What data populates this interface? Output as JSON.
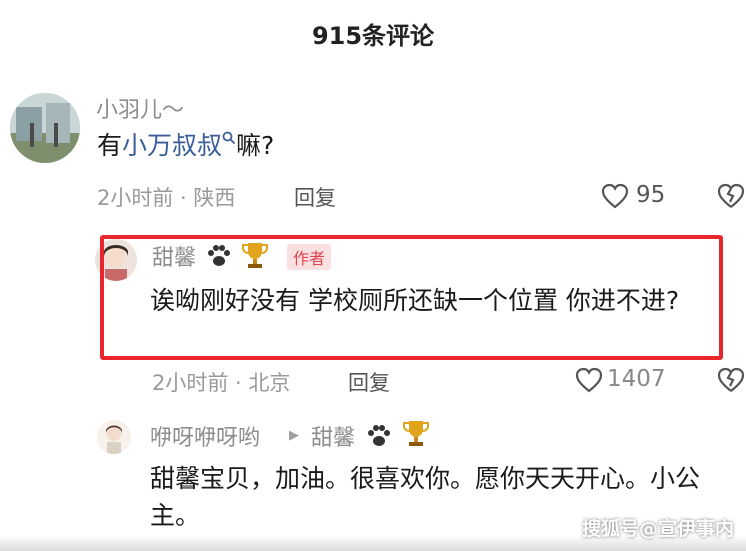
{
  "header": {
    "title": "915条评论"
  },
  "comments": [
    {
      "username": "小羽儿～",
      "text_before": "有",
      "mention": "小万叔叔",
      "text_after": "嘛?",
      "meta": "2小时前 · 陕西",
      "reply_label": "回复",
      "likes": "95"
    },
    {
      "username": "甜馨",
      "author_tag": "作者",
      "text": "诶呦刚好没有 学校厕所还缺一个位置 你进不进?",
      "meta": "2小时前 · 北京",
      "reply_label": "回复",
      "likes": "1407"
    },
    {
      "username": "咿呀咿呀哟",
      "reply_to": "甜馨",
      "text": "甜馨宝贝，加油。很喜欢你。愿你天天开心。小公主。"
    }
  ],
  "watermark": "搜狐号@宣伊事内",
  "colors": {
    "highlight": "#e8262c",
    "mention": "#3b5e99",
    "author_tag": "#e0454f"
  },
  "icons": [
    "search-icon",
    "heart-icon",
    "broken-heart-icon",
    "paw-icon",
    "trophy-icon",
    "play-arrow-icon"
  ]
}
